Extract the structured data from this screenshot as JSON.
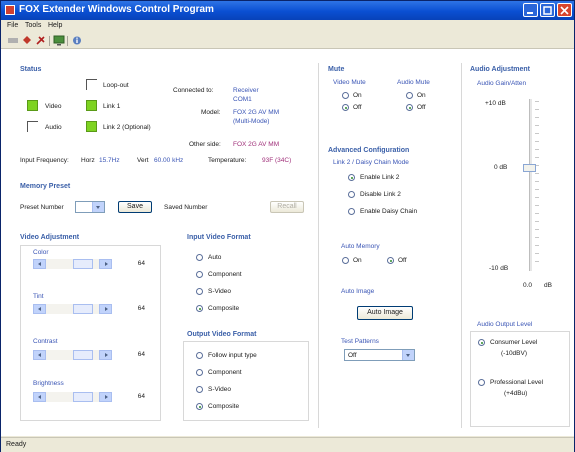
{
  "window": {
    "title": "FOX Extender Windows Control Program"
  },
  "menu": [
    "File",
    "Tools",
    "Help"
  ],
  "toolbar": {
    "icons": [
      "disconnect-icon",
      "connect-icon",
      "settings-icon",
      "monitor-icon",
      "about-icon"
    ]
  },
  "status": {
    "header": "Status",
    "video_label": "Video",
    "audio_label": "Audio",
    "loopout_label": "Loop-out",
    "link1_label": "Link 1",
    "link2_label": "Link 2 (Optional)",
    "connected_to_label": "Connected to:",
    "connected_to_value": "Receiver",
    "com_value": "COM1",
    "model_label": "Model:",
    "model_value_1": "FOX 2G AV MM",
    "model_value_2": "(Multi-Mode)",
    "other_side_label": "Other side:",
    "other_side_value": "FOX 2G AV MM",
    "input_freq_label": "Input Frequency:",
    "horz_label": "Horz",
    "horz_value": "15.7Hz",
    "vert_label": "Vert",
    "vert_value": "60.00 kHz",
    "temp_label": "Temperature:",
    "temp_value": "93F (34C)"
  },
  "memory": {
    "header": "Memory Preset",
    "preset_label": "Preset Number",
    "preset_value": "",
    "save_label": "Save",
    "saved_label": "Saved Number",
    "recall_label": "Recall"
  },
  "video_adjustment": {
    "header": "Video Adjustment",
    "sliders": [
      {
        "label": "Color",
        "value": "64"
      },
      {
        "label": "Tint",
        "value": "64"
      },
      {
        "label": "Contrast",
        "value": "64"
      },
      {
        "label": "Brightness",
        "value": "64"
      }
    ]
  },
  "input_format": {
    "header": "Input Video Format",
    "options": [
      "Auto",
      "Component",
      "S-Video",
      "Composite"
    ],
    "selected": 3
  },
  "output_format": {
    "header": "Output Video Format",
    "options": [
      "Follow input type",
      "Component",
      "S-Video",
      "Composite"
    ],
    "selected": 3
  },
  "mute": {
    "header": "Mute",
    "video_label": "Video Mute",
    "audio_label": "Audio Mute",
    "on_label": "On",
    "off_label": "Off"
  },
  "advanced": {
    "header": "Advanced Configuration",
    "sub_label": "Link 2 / Daisy Chain Mode",
    "options": [
      "Enable Link 2",
      "Disable Link 2",
      "Enable Daisy Chain"
    ],
    "selected": 0,
    "auto_memory_label": "Auto Memory",
    "on_label": "On",
    "off_label": "Off",
    "auto_image_label": "Auto Image",
    "auto_image_button": "Auto Image",
    "test_patterns_label": "Test Patterns",
    "test_patterns_value": "Off"
  },
  "audio": {
    "header": "Audio Adjustment",
    "gain_label": "Audio Gain/Atten",
    "top_label": "+10 dB",
    "mid_label": "0 dB",
    "bottom_label": "-10 dB",
    "value": "0.0",
    "unit": "dB",
    "output_level_label": "Audio Output Level",
    "consumer_label_1": "Consumer Level",
    "consumer_label_2": "(-10dBV)",
    "professional_label_1": "Professional Level",
    "professional_label_2": "(+4dBu)"
  },
  "statusbar": {
    "text": "Ready"
  },
  "colors": {
    "title_bar": "#0a4fd2",
    "section_header": "#3a5fa8",
    "led_on": "#7ed321"
  }
}
